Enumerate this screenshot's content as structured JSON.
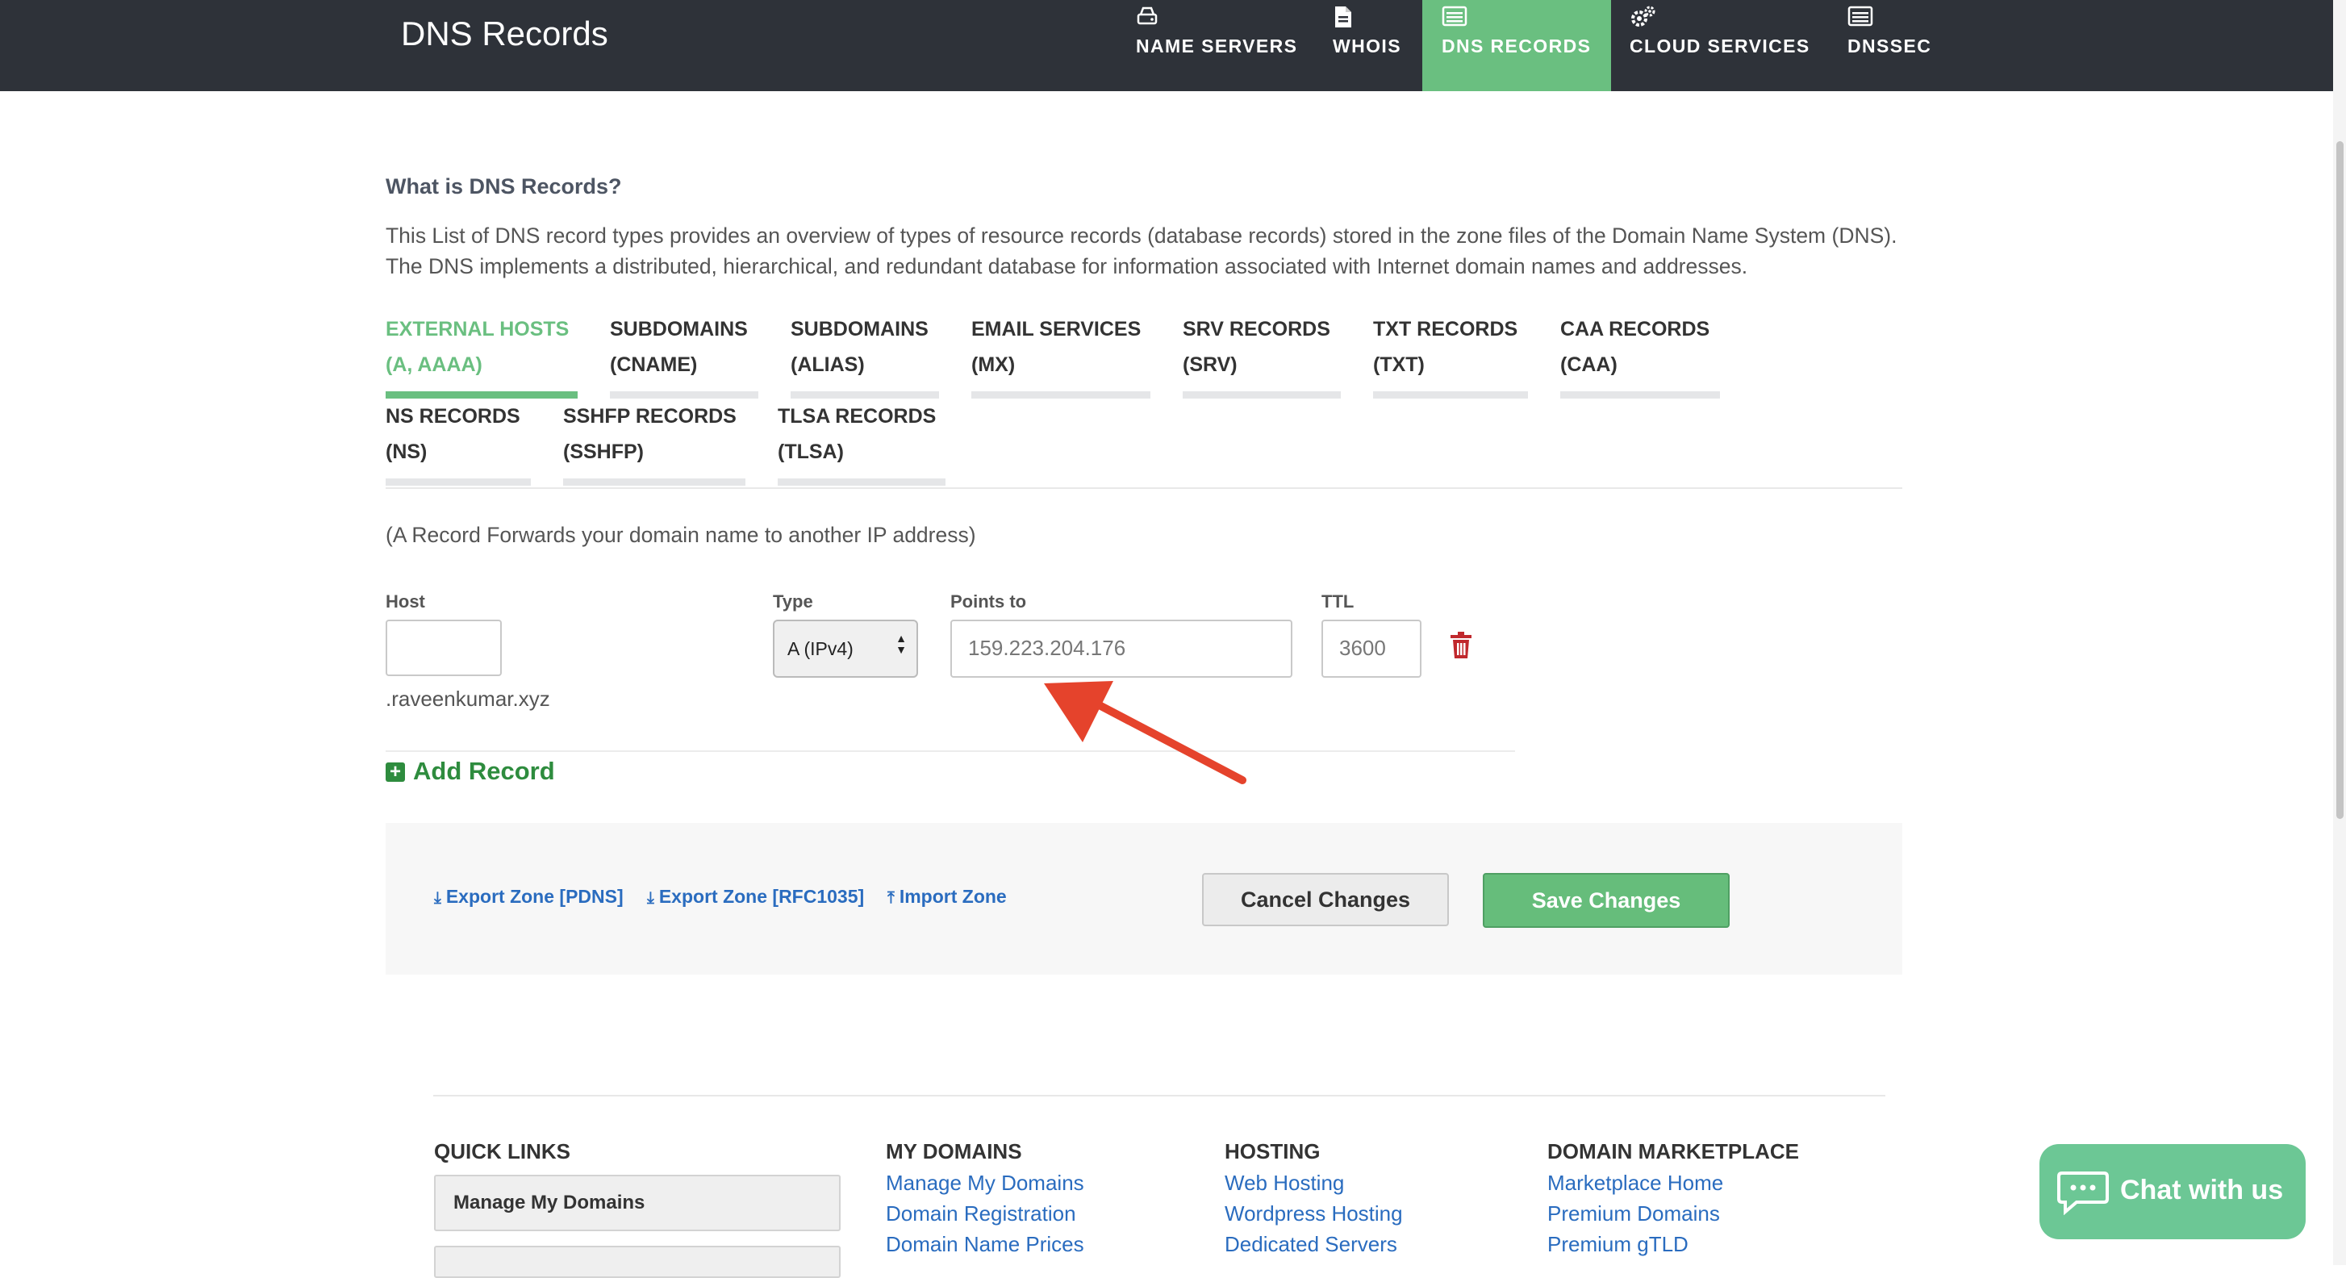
{
  "header": {
    "title": "DNS Records",
    "nav": [
      {
        "label": "NAME SERVERS",
        "icon": "hard-drive-icon",
        "active": false
      },
      {
        "label": "WHOIS",
        "icon": "document-icon",
        "active": false
      },
      {
        "label": "DNS RECORDS",
        "icon": "list-icon",
        "active": true
      },
      {
        "label": "CLOUD SERVICES",
        "icon": "gears-icon",
        "active": false
      },
      {
        "label": "DNSSEC",
        "icon": "list-icon",
        "active": false
      }
    ]
  },
  "intro": {
    "question": "What is DNS Records?",
    "description": "This List of DNS record types provides an overview of types of resource records (database records) stored in the zone files of the Domain Name System (DNS). The DNS implements a distributed, hierarchical, and redundant database for information associated with Internet domain names and addresses."
  },
  "tabs": [
    {
      "line1": "EXTERNAL HOSTS",
      "line2": "(A, AAAA)",
      "active": true
    },
    {
      "line1": "SUBDOMAINS",
      "line2": "(CNAME)",
      "active": false
    },
    {
      "line1": "SUBDOMAINS",
      "line2": "(ALIAS)",
      "active": false
    },
    {
      "line1": "EMAIL SERVICES",
      "line2": "(MX)",
      "active": false
    },
    {
      "line1": "SRV RECORDS",
      "line2": "(SRV)",
      "active": false
    },
    {
      "line1": "TXT RECORDS",
      "line2": "(TXT)",
      "active": false
    },
    {
      "line1": "CAA RECORDS",
      "line2": "(CAA)",
      "active": false
    },
    {
      "line1": "NS RECORDS",
      "line2": "(NS)",
      "active": false
    },
    {
      "line1": "SSHFP RECORDS",
      "line2": "(SSHFP)",
      "active": false
    },
    {
      "line1": "TLSA RECORDS",
      "line2": "(TLSA)",
      "active": false
    }
  ],
  "record_form": {
    "hint": "(A Record Forwards your domain name to another IP address)",
    "host_label": "Host",
    "host_value": "",
    "host_suffix": ".raveenkumar.xyz",
    "type_label": "Type",
    "type_value": "A (IPv4)",
    "points_to_label": "Points to",
    "points_to_value": "159.223.204.176",
    "ttl_label": "TTL",
    "ttl_value": "3600",
    "add_record": "Add Record",
    "accent_color": "#2e8c3e",
    "delete_color": "#c0282d",
    "arrow_color": "#e5432c"
  },
  "actions": {
    "export_pdns": "Export Zone [PDNS]",
    "export_rfc": "Export Zone [RFC1035]",
    "import_zone": "Import Zone",
    "cancel": "Cancel Changes",
    "save": "Save Changes"
  },
  "footer": {
    "quick_links": {
      "title": "QUICK LINKS",
      "button": "Manage My Domains"
    },
    "my_domains": {
      "title": "MY DOMAINS",
      "links": [
        "Manage My Domains",
        "Domain Registration",
        "Domain Name Prices"
      ]
    },
    "hosting": {
      "title": "HOSTING",
      "links": [
        "Web Hosting",
        "Wordpress Hosting",
        "Dedicated Servers"
      ]
    },
    "marketplace": {
      "title": "DOMAIN MARKETPLACE",
      "links": [
        "Marketplace Home",
        "Premium Domains",
        "Premium gTLD"
      ]
    }
  },
  "chat": {
    "label": "Chat with us",
    "icon": "chat-bubble-icon"
  }
}
